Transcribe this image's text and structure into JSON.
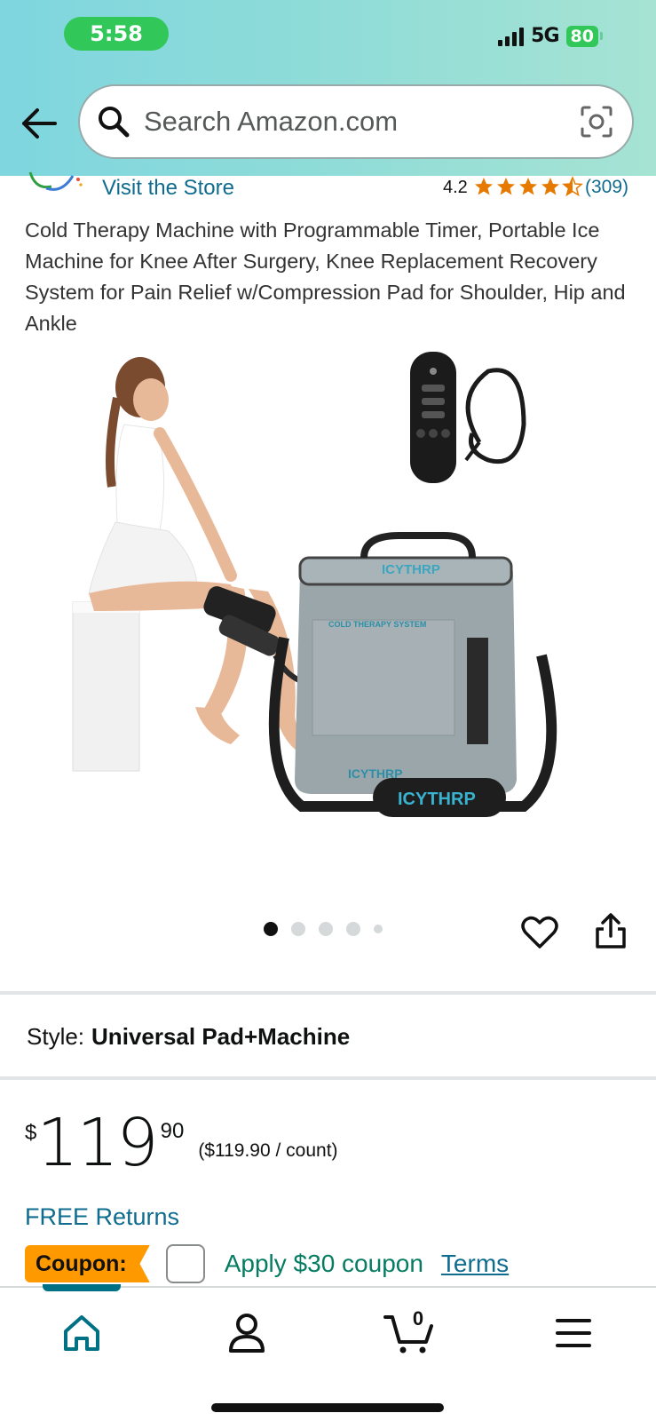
{
  "status_bar": {
    "time": "5:58",
    "network": "5G",
    "battery": "80"
  },
  "search": {
    "placeholder": "Search Amazon.com"
  },
  "store": {
    "link_text": "Visit the Store",
    "rating": "4.2",
    "rating_stars": 4.2,
    "review_count": "(309)"
  },
  "product": {
    "title": "Cold Therapy Machine with Programmable Timer, Portable Ice Machine for Knee After Surgery, Knee Replacement Recovery System for Pain Relief w/Compression Pad for Shoulder, Hip and Ankle",
    "image_brand_text": "ICYTHRP",
    "image_panel_text": "COLD THERAPY SYSTEM",
    "image_count": 5,
    "current_image": 1
  },
  "style": {
    "label": "Style:",
    "value": "Universal Pad+Machine"
  },
  "price": {
    "symbol": "$",
    "whole": "119",
    "fraction": "90",
    "unit_price": "($119.90 / count)"
  },
  "returns": {
    "text": "FREE Returns"
  },
  "coupon": {
    "badge": "Coupon:",
    "text": "Apply $30 coupon",
    "terms": "Terms"
  },
  "bottom_nav": {
    "cart_count": "0"
  },
  "colors": {
    "link": "#0f6c8f",
    "star": "#e67a00",
    "coupon_badge": "#ff9900",
    "coupon_text": "#067d62",
    "nav_active": "#007185"
  }
}
